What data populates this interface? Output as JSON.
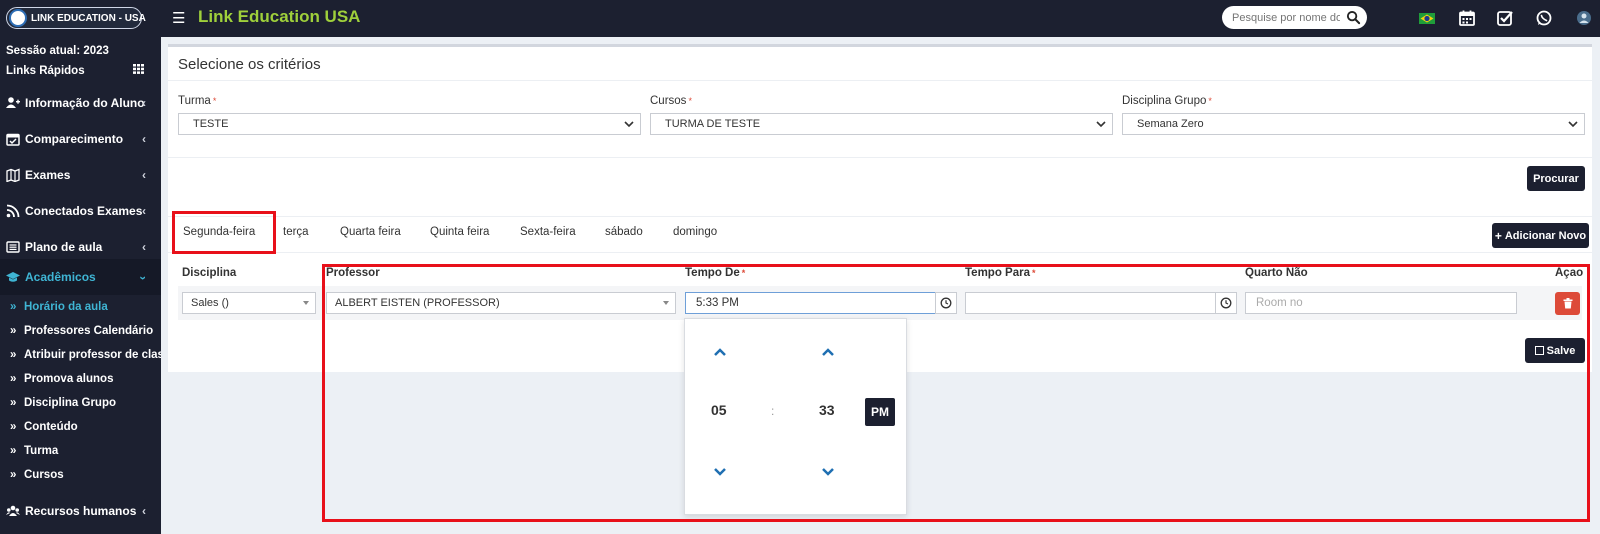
{
  "header": {
    "logo_text": "LINK EDUCATION - USA",
    "app_title": "Link Education USA",
    "search_placeholder": "Pesquise por nome do al",
    "icons": [
      "menu-icon",
      "search-icon",
      "brazil-flag-icon",
      "calendar-icon",
      "check-square-icon",
      "whatsapp-icon",
      "user-avatar-icon"
    ]
  },
  "sidebar": {
    "session": "Sessão atual: 2023",
    "quick_links": "Links Rápidos",
    "items": [
      {
        "label": "Informação do Aluno",
        "icon": "user-plus-icon"
      },
      {
        "label": "Comparecimento",
        "icon": "calendar-check-icon"
      },
      {
        "label": "Exames",
        "icon": "map-icon"
      },
      {
        "label": "Conectados Exames",
        "icon": "rss-icon"
      },
      {
        "label": "Plano de aula",
        "icon": "list-alt-icon"
      },
      {
        "label": "Acadêmicos",
        "icon": "graduation-cap-icon"
      },
      {
        "label": "Recursos humanos",
        "icon": "sitemap-icon"
      }
    ],
    "sub_items": [
      {
        "label": "Horário da aula"
      },
      {
        "label": "Professores Calendário"
      },
      {
        "label": "Atribuir professor de classe"
      },
      {
        "label": "Promova alunos"
      },
      {
        "label": "Disciplina Grupo"
      },
      {
        "label": "Conteúdo"
      },
      {
        "label": "Turma"
      },
      {
        "label": "Cursos"
      }
    ]
  },
  "criteria": {
    "title": "Selecione os critérios",
    "turma_label": "Turma",
    "turma_value": "TESTE",
    "cursos_label": "Cursos",
    "cursos_value": "TURMA DE TESTE",
    "grupo_label": "Disciplina Grupo",
    "grupo_value": "Semana Zero",
    "required_mark": "*",
    "search_button": "Procurar"
  },
  "tabs": [
    "Segunda-feira",
    "terça",
    "Quarta feira",
    "Quinta feira",
    "Sexta-feira",
    "sábado",
    "domingo"
  ],
  "add_button": "Adicionar Novo",
  "table": {
    "headers": {
      "disciplina": "Disciplina",
      "professor": "Professor",
      "tempo_de": "Tempo De",
      "tempo_para": "Tempo Para",
      "quarto": "Quarto Não",
      "acao": "Açao"
    },
    "row": {
      "disciplina": "Sales ()",
      "professor": "ALBERT EISTEN (PROFESSOR)",
      "tempo_de": "5:33 PM",
      "tempo_para": "",
      "quarto_placeholder": "Room no"
    }
  },
  "save_button": "Salve",
  "time_picker": {
    "hour": "05",
    "separator": ":",
    "minute": "33",
    "meridian": "PM"
  },
  "colors": {
    "sidebar_bg": "#1c2030",
    "accent_green": "#9fd03b",
    "accent_cyan": "#3fb5d4",
    "highlight_red": "#e8101a",
    "danger": "#dd4b39"
  }
}
